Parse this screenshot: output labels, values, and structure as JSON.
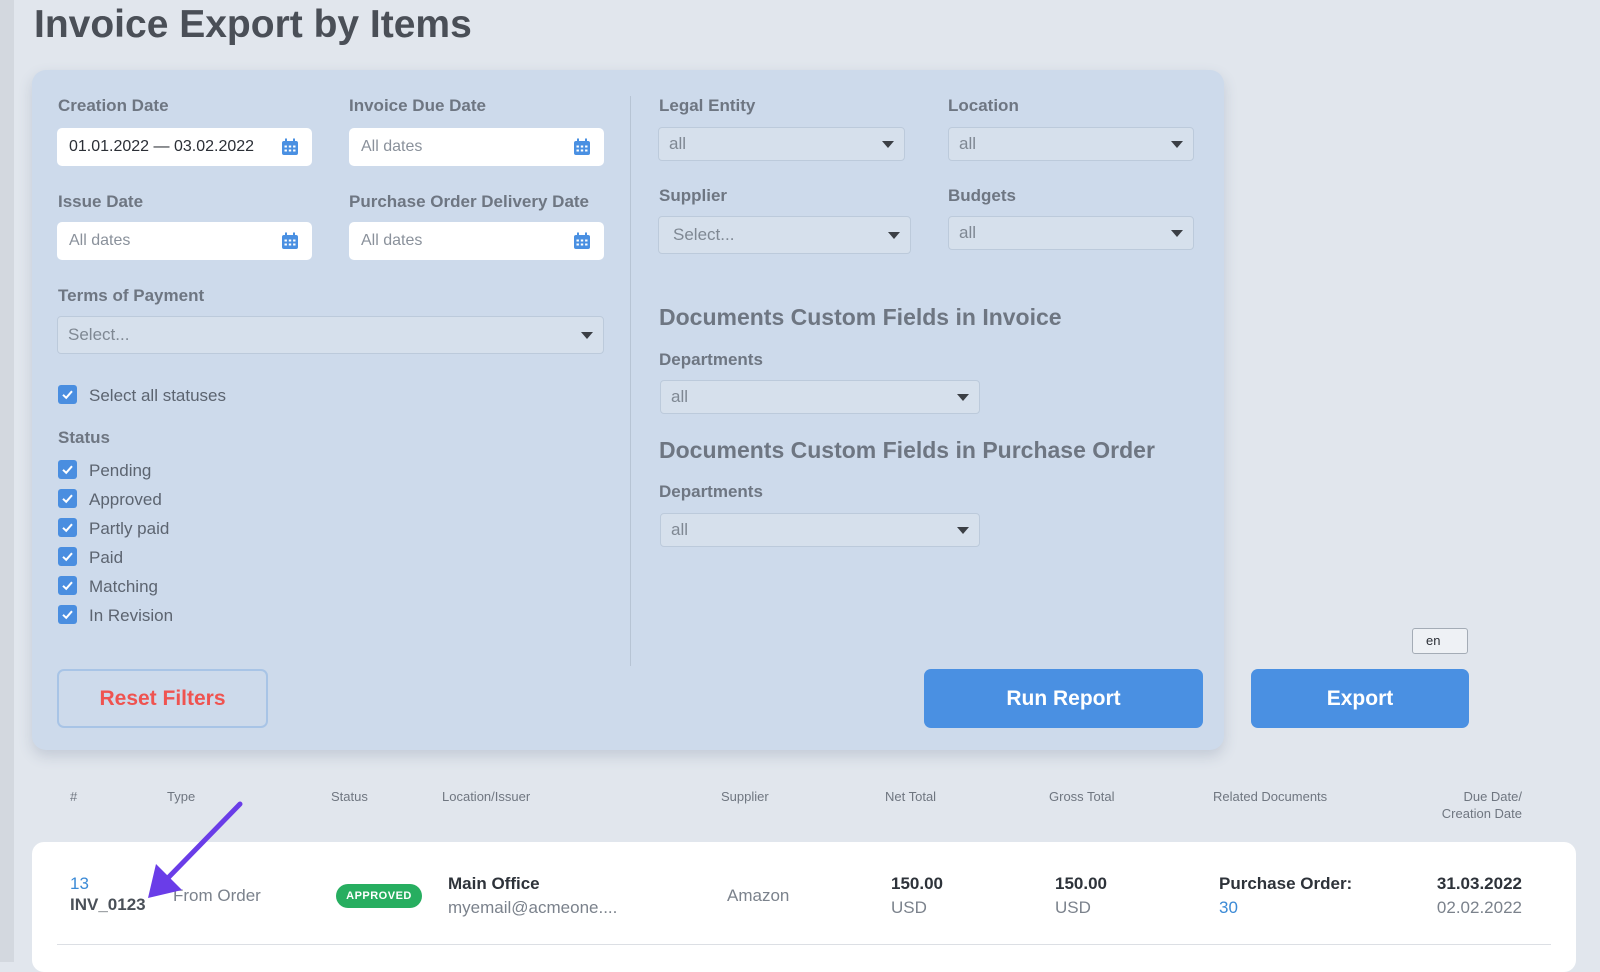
{
  "page": {
    "title": "Invoice Export by Items"
  },
  "filters": {
    "creation_date": {
      "label": "Creation Date",
      "value": "01.01.2022 — 03.02.2022"
    },
    "invoice_due_date": {
      "label": "Invoice Due Date",
      "placeholder": "All dates"
    },
    "issue_date": {
      "label": "Issue Date",
      "placeholder": "All dates"
    },
    "po_delivery_date": {
      "label": "Purchase Order Delivery Date",
      "placeholder": "All dates"
    },
    "terms_of_payment": {
      "label": "Terms of Payment",
      "placeholder": "Select..."
    },
    "select_all_statuses": {
      "label": "Select all statuses",
      "checked": true
    },
    "status": {
      "label": "Status",
      "items": [
        {
          "label": "Pending",
          "checked": true
        },
        {
          "label": "Approved",
          "checked": true
        },
        {
          "label": "Partly paid",
          "checked": true
        },
        {
          "label": "Paid",
          "checked": true
        },
        {
          "label": "Matching",
          "checked": true
        },
        {
          "label": "In Revision",
          "checked": true
        }
      ]
    },
    "legal_entity": {
      "label": "Legal Entity",
      "value": "all"
    },
    "location": {
      "label": "Location",
      "value": "all"
    },
    "supplier": {
      "label": "Supplier",
      "placeholder": "Select..."
    },
    "budgets": {
      "label": "Budgets",
      "value": "all"
    },
    "custom_invoice": {
      "heading": "Documents Custom Fields in Invoice",
      "label": "Departments",
      "value": "all"
    },
    "custom_po": {
      "heading": "Documents Custom Fields in Purchase Order",
      "label": "Departments",
      "value": "all"
    }
  },
  "actions": {
    "reset": "Reset Filters",
    "run": "Run Report",
    "export": "Export",
    "language": "en"
  },
  "table": {
    "headers": {
      "num": "#",
      "type": "Type",
      "status": "Status",
      "location": "Location/Issuer",
      "supplier": "Supplier",
      "net": "Net Total",
      "gross": "Gross Total",
      "related": "Related Documents",
      "due_line1": "Due Date/",
      "due_line2": "Creation Date"
    },
    "rows": [
      {
        "num": "13",
        "invoice": "INV_0123",
        "type": "From Order",
        "status": "APPROVED",
        "location": "Main Office",
        "issuer": "myemail@acmeone....",
        "supplier": "Amazon",
        "net_amount": "150.00",
        "net_currency": "USD",
        "gross_amount": "150.00",
        "gross_currency": "USD",
        "related_label": "Purchase Order:",
        "related_link": "30",
        "due_date": "31.03.2022",
        "creation_date": "02.02.2022"
      }
    ]
  },
  "colors": {
    "accent": "#4a90e2",
    "approved_badge": "#27ae60",
    "reset_text": "#ef5350",
    "annotation_arrow": "#6a3de8"
  }
}
